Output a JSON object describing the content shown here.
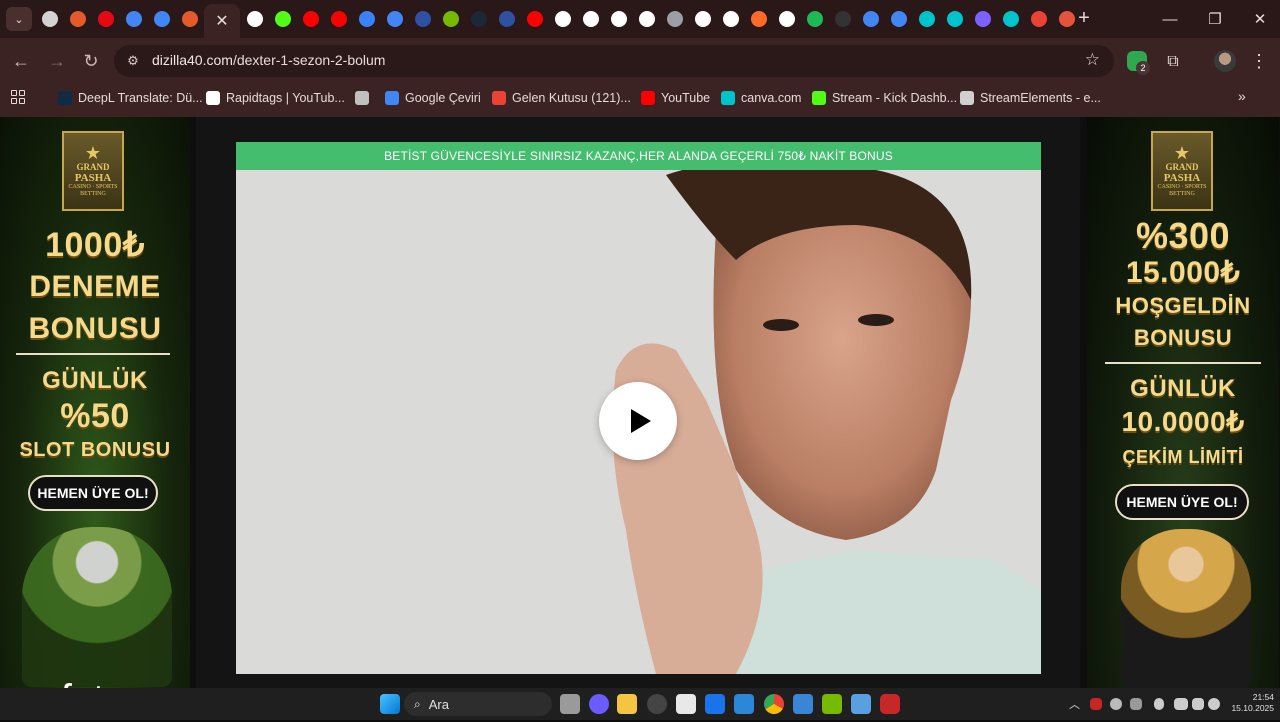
{
  "browser": {
    "tabs_menu_label": "⌄",
    "active_tab_close": "✕",
    "new_tab": "+",
    "window_controls": {
      "minimize": "—",
      "restore": "❐",
      "close": "✕"
    },
    "back": "←",
    "forward": "→",
    "reload": "↻",
    "url_host": "dizilla40.com",
    "url_path": "/dexter-1-sezon-2-bolum",
    "bookmark_star": "☆",
    "extensions_badge": "2",
    "menu": "⋮",
    "tab_favicon_colors": [
      "#d3d3d3",
      "#e45a2b",
      "#e50914",
      "#4285f4",
      "#4285f4",
      "#e45a2b",
      "#ffffff",
      "#53fc18",
      "#ff0000",
      "#ff0000",
      "#3b82f6",
      "#4285f4",
      "#2e51a2",
      "#76b900",
      "#1b2838",
      "#2e51a2",
      "#ff0000",
      "#ffffff",
      "#ffffff",
      "#ffffff",
      "#ffffff",
      "#9aa0a6",
      "#ffffff",
      "#ffffff",
      "#ff6a2b",
      "#ffffff",
      "#1db954",
      "#333333",
      "#4285f4",
      "#4285f4",
      "#00c4cc",
      "#00c4cc",
      "#7b61ff",
      "#00c4cc",
      "#ea4335",
      "#e5533d",
      "#6b6bff"
    ]
  },
  "bookmarks": [
    {
      "label": "DeepL Translate: Dü...",
      "icon": "deepl-icon",
      "color": "#0f2b46"
    },
    {
      "label": "Rapidtags | YouTub...",
      "icon": "rapidtags-icon",
      "color": "#ffffff"
    },
    {
      "label": "",
      "icon": "globe-icon",
      "color": "#c0c0c0"
    },
    {
      "label": "Google Çeviri",
      "icon": "google-translate-icon",
      "color": "#4285f4"
    },
    {
      "label": "Gelen Kutusu (121)...",
      "icon": "gmail-icon",
      "color": "#ea4335"
    },
    {
      "label": "YouTube",
      "icon": "youtube-icon",
      "color": "#ff0000"
    },
    {
      "label": "canva.com",
      "icon": "canva-icon",
      "color": "#00c4cc"
    },
    {
      "label": "Stream - Kick Dashb...",
      "icon": "kick-icon",
      "color": "#53fc18"
    },
    {
      "label": "StreamElements - e...",
      "icon": "streamelements-icon",
      "color": "#d0d0d0"
    }
  ],
  "bookmarks_more": "»",
  "banner_text": "BETİST GÜVENCESİYLE SINIRSIZ KAZANÇ,HER ALANDA GEÇERLİ 750₺ NAKİT BONUS",
  "ad_left": {
    "logo": {
      "l1": "GRAND",
      "l2": "PASHA",
      "l3": "CASINO · SPORTS BETTING",
      "star": "★"
    },
    "line1": "1000₺",
    "line2": "DENEME",
    "line3": "BONUSU",
    "line4": "GÜNLÜK",
    "line5": "%50",
    "line6": "SLOT BONUSU",
    "cta": "HEMEN ÜYE OL!"
  },
  "ad_right": {
    "logo": {
      "l1": "GRAND",
      "l2": "PASHA",
      "l3": "CASINO · SPORTS BETTING",
      "star": "★"
    },
    "line1": "%300",
    "line2": "15.000₺",
    "line3": "HOŞGELDİN",
    "line4": "BONUSU",
    "line5": "GÜNLÜK",
    "line6": "10.0000₺",
    "line7": "ÇEKİM LİMİTİ",
    "cta": "HEMEN ÜYE OL!"
  },
  "watermark": "exxfat",
  "taskbar": {
    "search_placeholder": "Ara",
    "search_icon": "⌕",
    "time": "21:54",
    "date": "15.10.2025",
    "tray_chevron": "︿"
  }
}
